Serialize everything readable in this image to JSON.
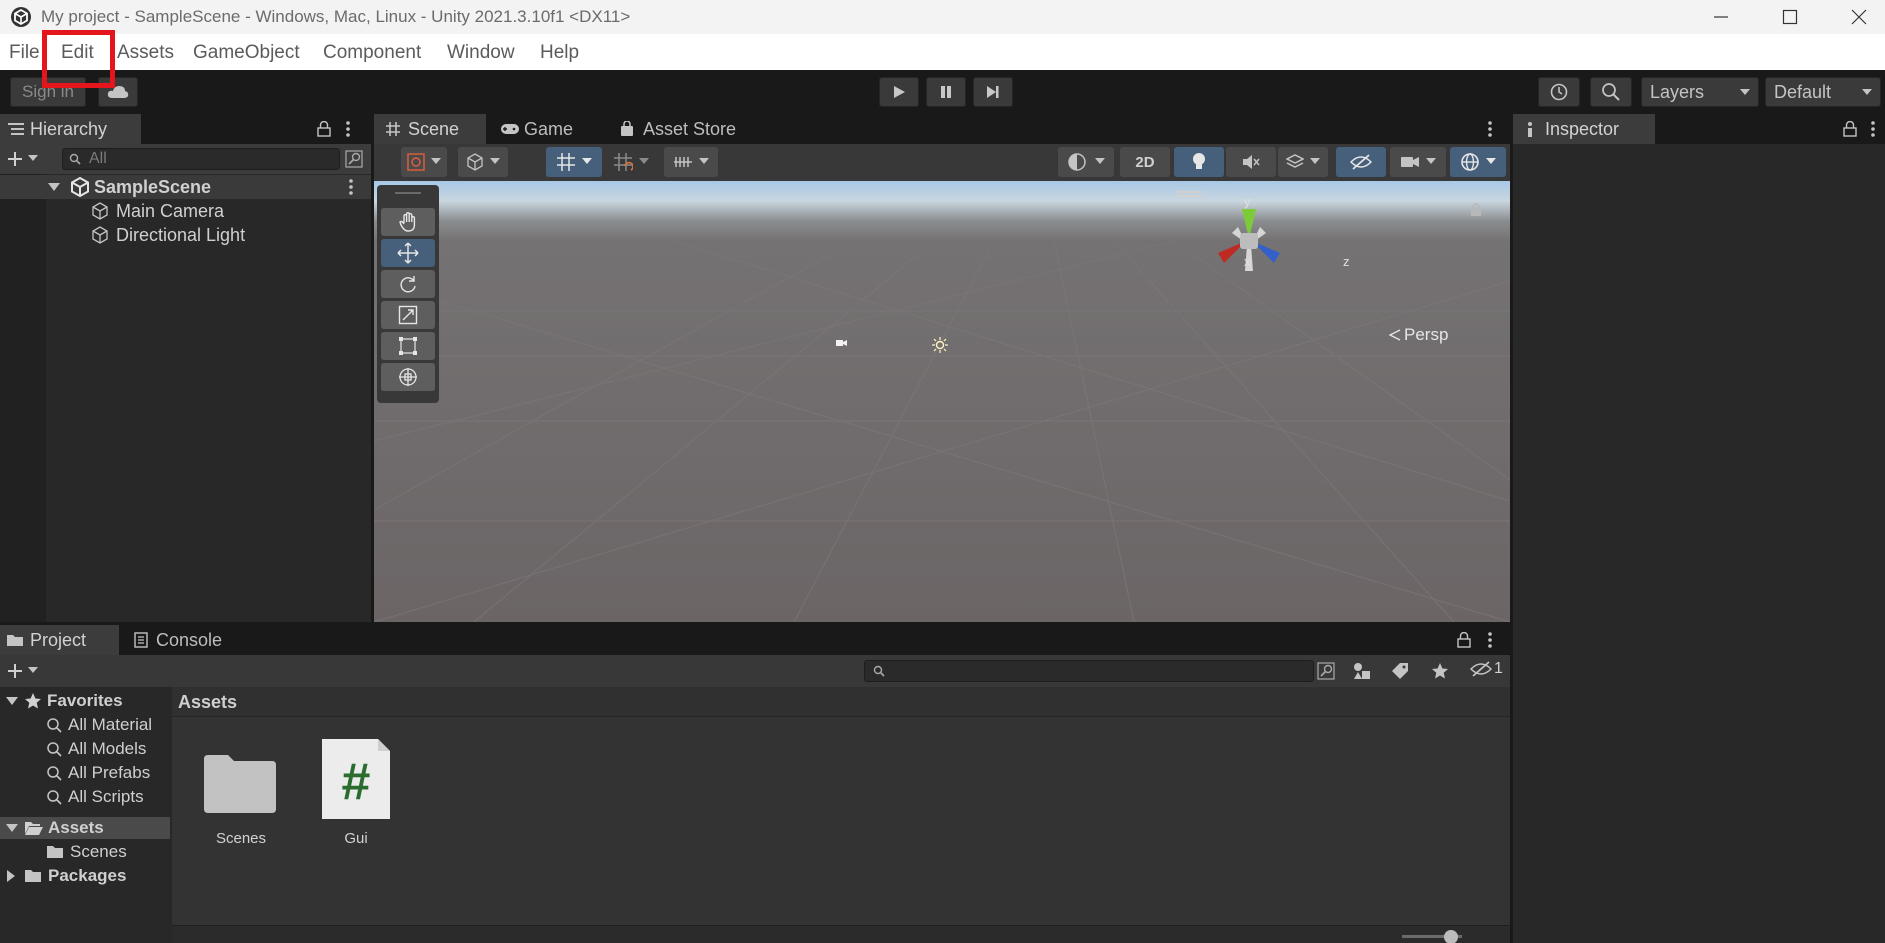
{
  "window": {
    "title": "My project - SampleScene - Windows, Mac, Linux - Unity 2021.3.10f1 <DX11>",
    "controls": [
      "minimize-icon",
      "maximize-icon",
      "close-icon"
    ]
  },
  "menu": {
    "items": [
      "File",
      "Edit",
      "Assets",
      "GameObject",
      "Component",
      "Window",
      "Help"
    ],
    "highlighted": "Edit",
    "highlight_color": "#e4161b"
  },
  "toolbar": {
    "sign_in": "Sign in",
    "layers": "Layers",
    "layout": "Default"
  },
  "hierarchy": {
    "tab": "Hierarchy",
    "search_placeholder": "All",
    "scene": "SampleScene",
    "items": [
      "Main Camera",
      "Directional Light"
    ]
  },
  "scene_tabs": {
    "tabs": [
      "Scene",
      "Game",
      "Asset Store"
    ],
    "active": "Scene"
  },
  "scene_toolbar": {
    "btn_2d": "2D"
  },
  "scene_gizmo": {
    "axis_y": "y",
    "axis_x": "x",
    "axis_z": "z",
    "projection": "Persp"
  },
  "inspector": {
    "tab": "Inspector"
  },
  "bottom_tabs": {
    "tabs": [
      "Project",
      "Console"
    ],
    "active": "Project",
    "hidden_count": "1"
  },
  "project": {
    "favorites_label": "Favorites",
    "favorites": [
      "All Material",
      "All Models",
      "All Prefabs",
      "All Scripts"
    ],
    "assets_label": "Assets",
    "asset_children": [
      "Scenes"
    ],
    "packages_label": "Packages",
    "breadcrumb": "Assets",
    "items": [
      {
        "name": "Scenes",
        "icon": "folder-icon"
      },
      {
        "name": "Gui",
        "icon": "csharp-script-icon"
      }
    ]
  },
  "colors": {
    "accent": "#46607c",
    "panel": "#282828",
    "script_icon": "#2a6d2f"
  }
}
